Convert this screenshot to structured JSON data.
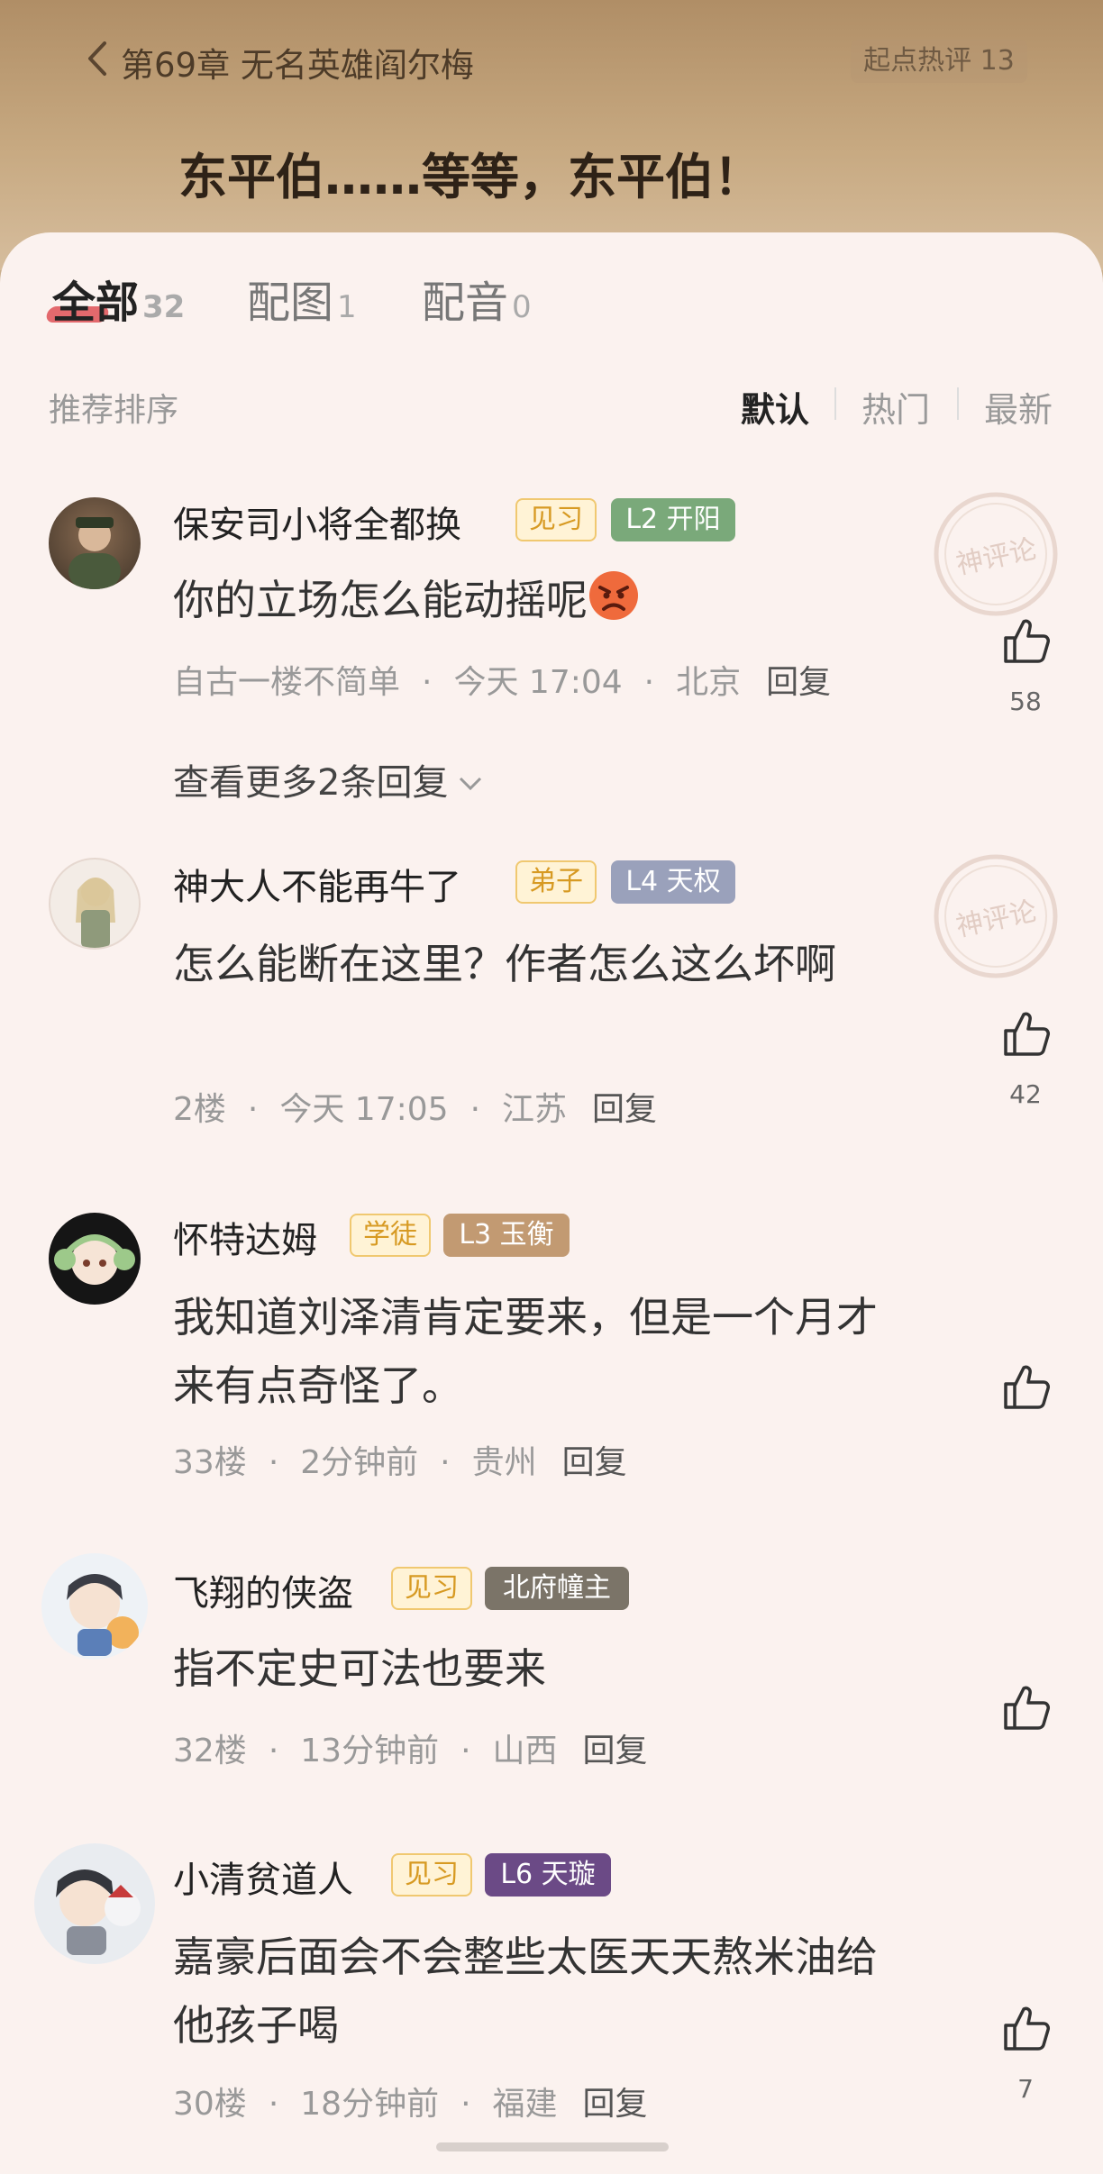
{
  "header": {
    "chapter_title": "第69章 无名英雄阎尔梅",
    "hot_label": "起点热评 13",
    "quote": "东平伯……等等，东平伯！"
  },
  "tabs": [
    {
      "label": "全部",
      "count": "32"
    },
    {
      "label": "配图",
      "count": "1"
    },
    {
      "label": "配音",
      "count": "0"
    }
  ],
  "sort": {
    "label": "推荐排序",
    "options": [
      "默认",
      "热门",
      "最新"
    ],
    "selected": "默认"
  },
  "comments": [
    {
      "user": "保安司小将全都换",
      "fan_badge": "见习",
      "level_badge": "L2 开阳",
      "level_color": "#7aa97a",
      "text": "你的立场怎么能动摇呢",
      "floor": "自古一楼不简单",
      "time": "今天 17:04",
      "location": "北京",
      "reply": "回复",
      "likes": "58",
      "stamp": "神评论",
      "more_replies": "查看更多2条回复"
    },
    {
      "user": "神大人不能再牛了",
      "fan_badge": "弟子",
      "level_badge": "L4 天权",
      "level_color": "#9aa1bb",
      "text": "怎么能断在这里？作者怎么这么坏啊",
      "floor": "2楼",
      "time": "今天 17:05",
      "location": "江苏",
      "reply": "回复",
      "likes": "42",
      "stamp": "神评论"
    },
    {
      "user": "怀特达姆",
      "fan_badge": "学徒",
      "level_badge": "L3 玉衡",
      "level_color": "#c29a72",
      "text": "我知道刘泽清肯定要来，但是一个月才来有点奇怪了。",
      "floor": "33楼",
      "time": "2分钟前",
      "location": "贵州",
      "reply": "回复",
      "likes": ""
    },
    {
      "user": "飞翔的侠盗",
      "fan_badge": "见习",
      "level_badge": "北府幢主",
      "level_color": "#7b7468",
      "text": "指不定史可法也要来",
      "floor": "32楼",
      "time": "13分钟前",
      "location": "山西",
      "reply": "回复",
      "likes": ""
    },
    {
      "user": "小清贫道人",
      "fan_badge": "见习",
      "level_badge": "L6 天璇",
      "level_color": "#6b4a86",
      "text": "嘉豪后面会不会整些太医天天熬米油给他孩子喝",
      "floor": "30楼",
      "time": "18分钟前",
      "location": "福建",
      "reply": "回复",
      "likes": "7"
    }
  ]
}
